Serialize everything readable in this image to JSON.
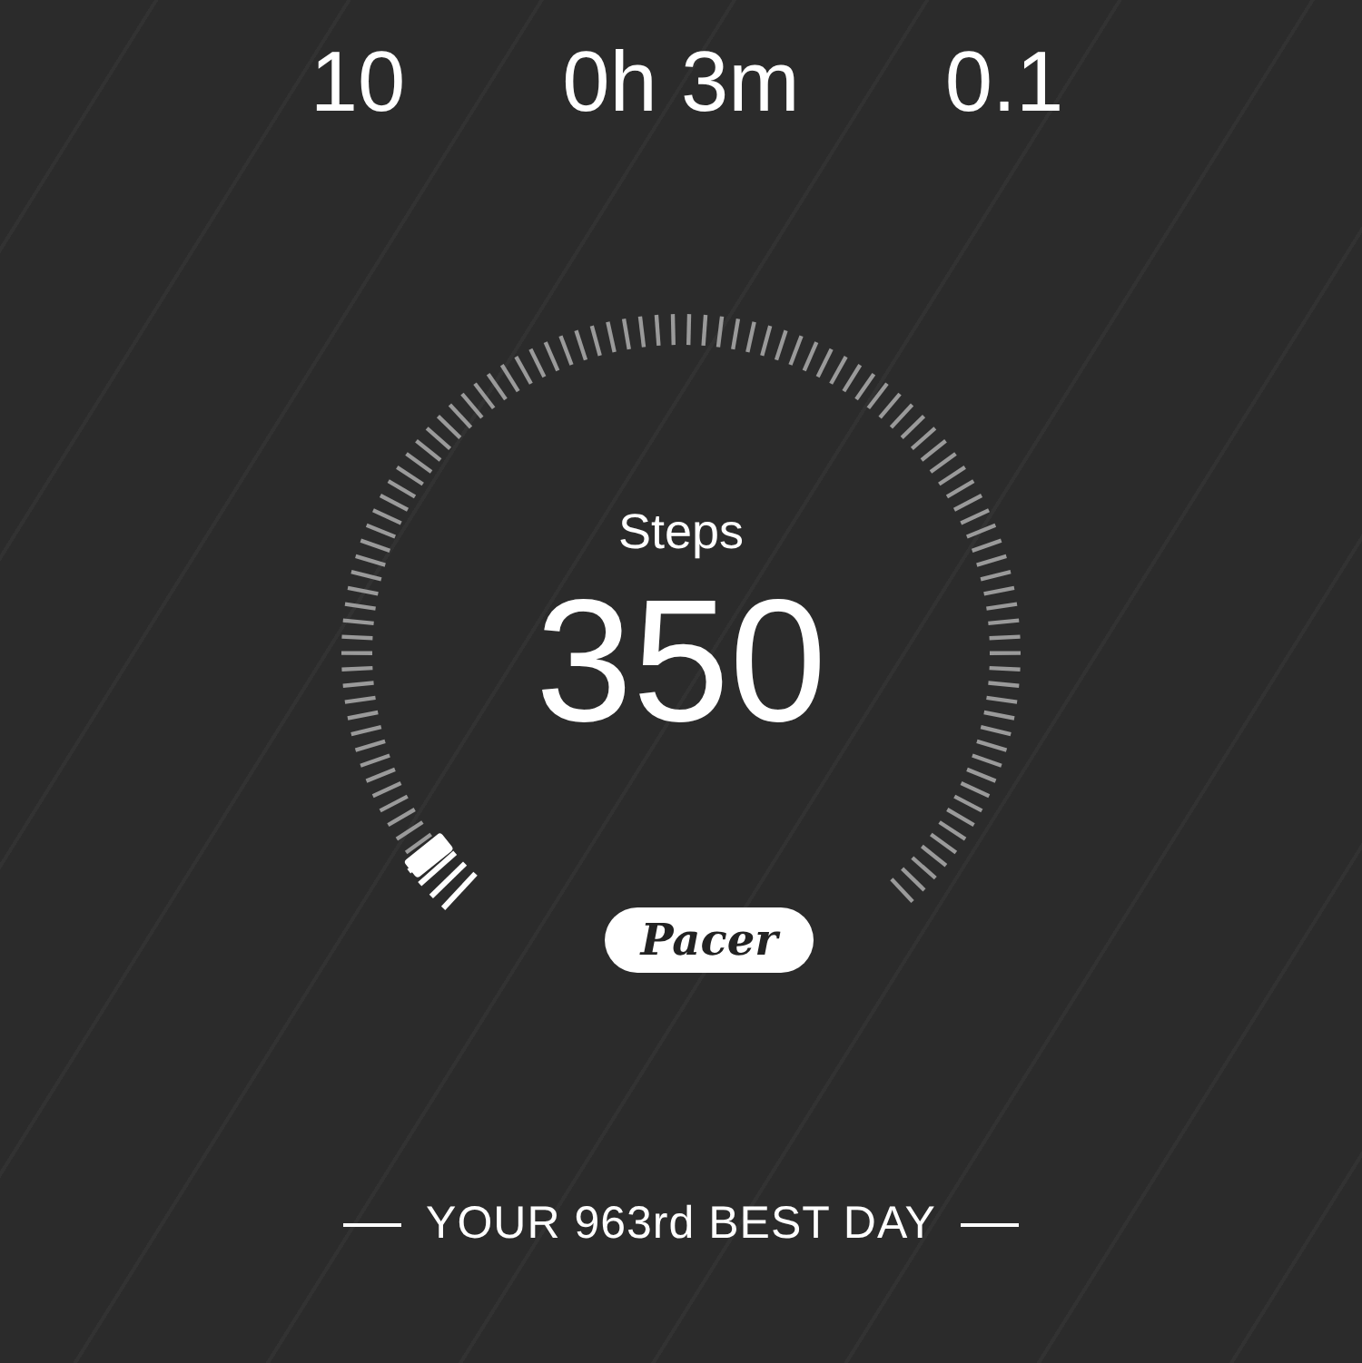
{
  "stats": [
    {
      "value": "10"
    },
    {
      "value": "0h 3m"
    },
    {
      "value": "0.1"
    }
  ],
  "gauge": {
    "label": "Steps",
    "value": "350"
  },
  "logo": "Pacer",
  "footer": "YOUR 963rd BEST DAY"
}
